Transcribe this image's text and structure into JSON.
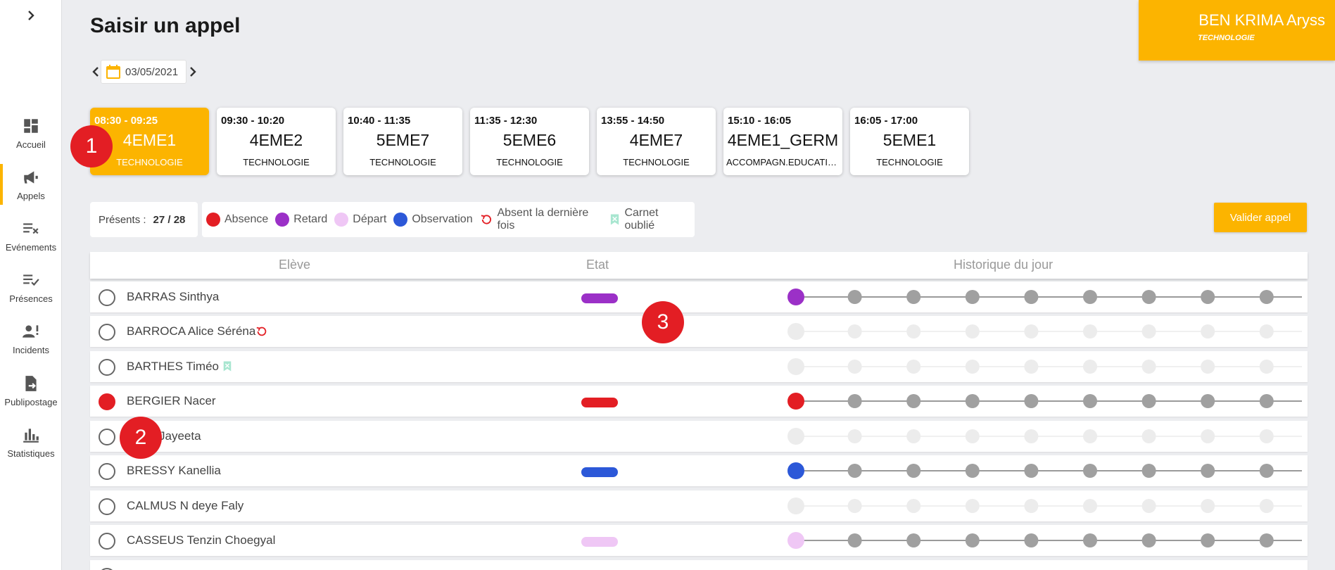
{
  "sidebar": {
    "items": [
      {
        "label": "Accueil",
        "icon": "dashboard-icon",
        "active": false
      },
      {
        "label": "Appels",
        "icon": "megaphone-icon",
        "active": true
      },
      {
        "label": "Evénements",
        "icon": "list-x-icon",
        "active": false
      },
      {
        "label": "Présences",
        "icon": "list-check-icon",
        "active": false
      },
      {
        "label": "Incidents",
        "icon": "person-alert-icon",
        "active": false
      },
      {
        "label": "Publipostage",
        "icon": "file-export-icon",
        "active": false
      },
      {
        "label": "Statistiques",
        "icon": "bar-chart-icon",
        "active": false
      }
    ]
  },
  "header": {
    "title": "Saisir un appel",
    "user_name": "BEN KRIMA Aryss",
    "user_subject": "TECHNOLOGIE"
  },
  "date": {
    "value": "03/05/2021"
  },
  "slots": [
    {
      "time": "08:30 - 09:25",
      "class": "4EME1",
      "subject": "TECHNOLOGIE",
      "active": true
    },
    {
      "time": "09:30 - 10:20",
      "class": "4EME2",
      "subject": "TECHNOLOGIE",
      "active": false
    },
    {
      "time": "10:40 - 11:35",
      "class": "5EME7",
      "subject": "TECHNOLOGIE",
      "active": false
    },
    {
      "time": "11:35 - 12:30",
      "class": "5EME6",
      "subject": "TECHNOLOGIE",
      "active": false
    },
    {
      "time": "13:55 - 14:50",
      "class": "4EME7",
      "subject": "TECHNOLOGIE",
      "active": false
    },
    {
      "time": "15:10 - 16:05",
      "class": "4EME1_GERM",
      "subject": "ACCOMPAGN.EDUCATIF...",
      "active": false
    },
    {
      "time": "16:05 - 17:00",
      "class": "5EME1",
      "subject": "TECHNOLOGIE",
      "active": false
    }
  ],
  "badges": [
    "1",
    "2",
    "3"
  ],
  "stats": {
    "presents_label": "Présents :",
    "presents_value": "27 / 28"
  },
  "legend": {
    "absence": "Absence",
    "retard": "Retard",
    "depart": "Départ",
    "observation": "Observation",
    "absent_last": "Absent la dernière fois",
    "carnet": "Carnet oublié"
  },
  "colors": {
    "accent": "#fcb400",
    "absence": "#e31e24",
    "retard": "#9b30c7",
    "depart": "#efc7f5",
    "observation": "#2c58d8",
    "carnet": "#a8e6d0",
    "history_gray": "#a0a0a0",
    "history_empty": "#ececec"
  },
  "validate_label": "Valider appel",
  "table": {
    "headers": {
      "student": "Elève",
      "state": "Etat",
      "history": "Historique du jour"
    },
    "rows": [
      {
        "name": "BARRAS Sinthya",
        "state": "retard",
        "flag": null
      },
      {
        "name": "BARROCA Alice Séréna",
        "state": null,
        "flag": "absent_last"
      },
      {
        "name": "BARTHES Timéo",
        "state": null,
        "flag": "carnet"
      },
      {
        "name": "BERGIER Nacer",
        "state": "absence",
        "flag": null
      },
      {
        "name": "Jayeeta",
        "state": null,
        "flag": null
      },
      {
        "name": "BRESSY Kanellia",
        "state": "observation",
        "flag": null
      },
      {
        "name": "CALMUS N deye Faly",
        "state": null,
        "flag": null
      },
      {
        "name": "CASSEUS Tenzin Choegyal",
        "state": "depart",
        "flag": null
      }
    ]
  }
}
